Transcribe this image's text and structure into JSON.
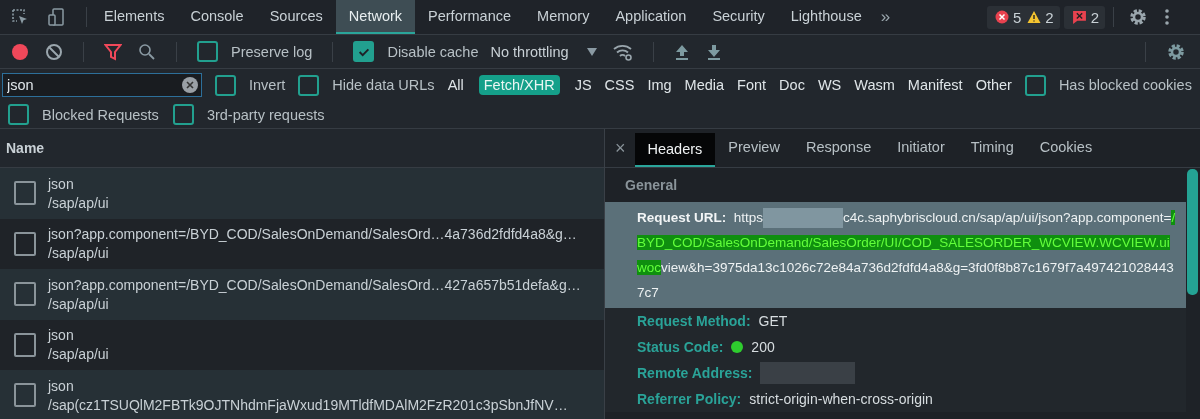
{
  "main_tabs": [
    {
      "label": "Elements",
      "selected": false
    },
    {
      "label": "Console",
      "selected": false
    },
    {
      "label": "Sources",
      "selected": false
    },
    {
      "label": "Network",
      "selected": true
    },
    {
      "label": "Performance",
      "selected": false
    },
    {
      "label": "Memory",
      "selected": false
    },
    {
      "label": "Application",
      "selected": false
    },
    {
      "label": "Security",
      "selected": false
    },
    {
      "label": "Lighthouse",
      "selected": false
    }
  ],
  "more_tabs": "»",
  "counters": {
    "errors": "5",
    "warnings": "2",
    "issues": "2"
  },
  "toolbar": {
    "preserve_log": {
      "label": "Preserve log",
      "checked": false
    },
    "disable_cache": {
      "label": "Disable cache",
      "checked": true
    },
    "throttling": "No throttling"
  },
  "filter": {
    "value": "json",
    "invert": {
      "label": "Invert",
      "checked": false
    },
    "hide_data_urls": {
      "label": "Hide data URLs",
      "checked": false
    },
    "types": [
      {
        "label": "All",
        "selected": false
      },
      {
        "label": "Fetch/XHR",
        "selected": true
      },
      {
        "label": "JS",
        "selected": false
      },
      {
        "label": "CSS",
        "selected": false
      },
      {
        "label": "Img",
        "selected": false
      },
      {
        "label": "Media",
        "selected": false
      },
      {
        "label": "Font",
        "selected": false
      },
      {
        "label": "Doc",
        "selected": false
      },
      {
        "label": "WS",
        "selected": false
      },
      {
        "label": "Wasm",
        "selected": false
      },
      {
        "label": "Manifest",
        "selected": false
      },
      {
        "label": "Other",
        "selected": false
      }
    ],
    "has_blocked_cookies": {
      "label": "Has blocked cookies",
      "checked": false
    },
    "blocked_requests": {
      "label": "Blocked Requests",
      "checked": false
    },
    "third_party": {
      "label": "3rd-party requests",
      "checked": false
    }
  },
  "requests": {
    "column": "Name",
    "rows": [
      {
        "name": "json",
        "path": "/sap/ap/ui"
      },
      {
        "name": "json?app.component=/BYD_COD/SalesOnDemand/SalesOrd…4a736d2fdfd4a8&g…",
        "path": "/sap/ap/ui"
      },
      {
        "name": "json?app.component=/BYD_COD/SalesOnDemand/SalesOrd…427a657b51defa&g…",
        "path": "/sap/ap/ui"
      },
      {
        "name": "json",
        "path": "/sap/ap/ui"
      },
      {
        "name": "json",
        "path": "/sap(cz1TSUQlM2FBTk9OJTNhdmFjaWxud19MTldfMDAlM2FzR201c3pSbnJfNV…"
      }
    ]
  },
  "details": {
    "close": "×",
    "tabs": [
      {
        "label": "Headers",
        "selected": true
      },
      {
        "label": "Preview",
        "selected": false
      },
      {
        "label": "Response",
        "selected": false
      },
      {
        "label": "Initiator",
        "selected": false
      },
      {
        "label": "Timing",
        "selected": false
      },
      {
        "label": "Cookies",
        "selected": false
      }
    ],
    "section": "General",
    "fields": [
      {
        "label": "Request URL:",
        "kind": "url",
        "selected": true,
        "parts": [
          {
            "kind": "plain",
            "text": "https"
          },
          {
            "kind": "redacted"
          },
          {
            "kind": "plain",
            "text": "c4c.saphybriscloud.cn/sap/ap/ui/json?app.component="
          },
          {
            "kind": "highlight",
            "text": "/BYD_COD/SalesOnDemand/SalesOrder/UI/COD_SALESORDER_WCVIEW.WCVIEW.uiwoc"
          },
          {
            "kind": "plain",
            "text": "view&h=3975da13c1026c72e84a736d2fdfd4a8&g=3fd0f8b87c1679f7a4974210284437c7"
          }
        ]
      },
      {
        "label": "Request Method:",
        "kind": "text",
        "selected": false,
        "value": "GET"
      },
      {
        "label": "Status Code:",
        "kind": "status",
        "selected": false,
        "value": "200",
        "color": "#2ecc2e"
      },
      {
        "label": "Remote Address:",
        "kind": "redacted",
        "selected": false
      },
      {
        "label": "Referrer Policy:",
        "kind": "text",
        "selected": false,
        "value": "strict-origin-when-cross-origin"
      }
    ]
  }
}
